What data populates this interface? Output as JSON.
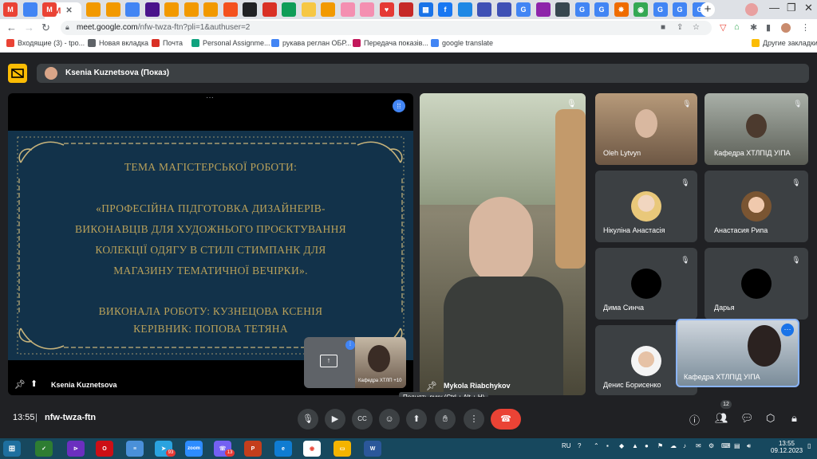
{
  "browser": {
    "active_tab_label": "M",
    "tab_icons": [
      "gmail",
      "google-sites",
      "gmail",
      "custom-app",
      "custom-app",
      "google-sites",
      "theater",
      "custom-app",
      "custom-app",
      "custom-app",
      "fire",
      "dark-circle",
      "plus-red",
      "green-square",
      "cloud",
      "custom-app",
      "pink",
      "pink",
      "heart",
      "red-dot",
      "classroom",
      "facebook",
      "diamond",
      "drive",
      "drive",
      "google",
      "mix",
      "bank",
      "google",
      "google",
      "paw",
      "maps",
      "google",
      "google",
      "github",
      "google"
    ],
    "new_tab_label": "+",
    "url_host": "meet.google.com",
    "url_path": "/nfw-twza-ftn?pli=1&authuser=2"
  },
  "bookmarks": [
    {
      "label": "Входящие (3) - tpo...",
      "icon": "gmail",
      "color": "#ea4335"
    },
    {
      "label": "Новая вкладка",
      "icon": "globe",
      "color": "#5f6368"
    },
    {
      "label": "Почта",
      "icon": "mail",
      "color": "#d93025"
    },
    {
      "label": "Personal Assignme...",
      "icon": "ai",
      "color": "#10a37f"
    },
    {
      "label": "рукава реглан ОБР...",
      "icon": "google",
      "color": "#4285f4"
    },
    {
      "label": "Передача показів...",
      "icon": "pin",
      "color": "#c2185b"
    },
    {
      "label": "google translate",
      "icon": "google",
      "color": "#4285f4"
    }
  ],
  "bookmarks_other": "Другие закладки",
  "meet": {
    "presenter_banner": "Ksenia Kuznetsova (Показ)",
    "slide_lines": [
      "ТЕМА МАГІСТЕРСЬКОЇ РОБОТИ:",
      "«ПРОФЕСІЙНА ПІДГОТОВКА ДИЗАЙНЕРІВ-",
      "ВИКОНАВЦІВ ДЛЯ ХУДОЖНЬОГО ПРОЄКТУВАННЯ",
      "КОЛЕКЦІЇ ОДЯГУ В СТИЛІ СТИМПАНК ДЛЯ",
      "МАГАЗИНУ ТЕМАТИЧНОЇ ВЕЧІРКИ».",
      "ВИКОНАЛА РОБОТУ: КУЗНЕЦОВА КСЕНІЯ",
      "КЕРІВНИК: ПОПОВА ТЕТЯНА"
    ],
    "presenter_name": "Ksenia Kuznetsova",
    "pip_label": "Кафедра ХТЛП +10",
    "speaker_name": "Mykola Riabchykov",
    "participants": [
      {
        "name": "Oleh Lytvyn"
      },
      {
        "name": "Кафедра ХТЛПІД УІПА"
      },
      {
        "name": "Нікуліна Анастасія"
      },
      {
        "name": "Анастасия Рипа"
      },
      {
        "name": "Дима Синча"
      },
      {
        "name": "Дарья"
      },
      {
        "name": "Денис Борисенко"
      },
      {
        "name": "Кафедра ХТЛПІД УІПА"
      }
    ],
    "tooltip": "Поднять руку (Ctrl + Alt + H)",
    "time": "13:55",
    "meeting_code": "nfw-twza-ftn",
    "participant_count": "12"
  },
  "taskbar": {
    "lang": "RU",
    "clock_time": "13:55",
    "clock_date": "09.12.2023",
    "badges": [
      "93",
      "13"
    ]
  }
}
